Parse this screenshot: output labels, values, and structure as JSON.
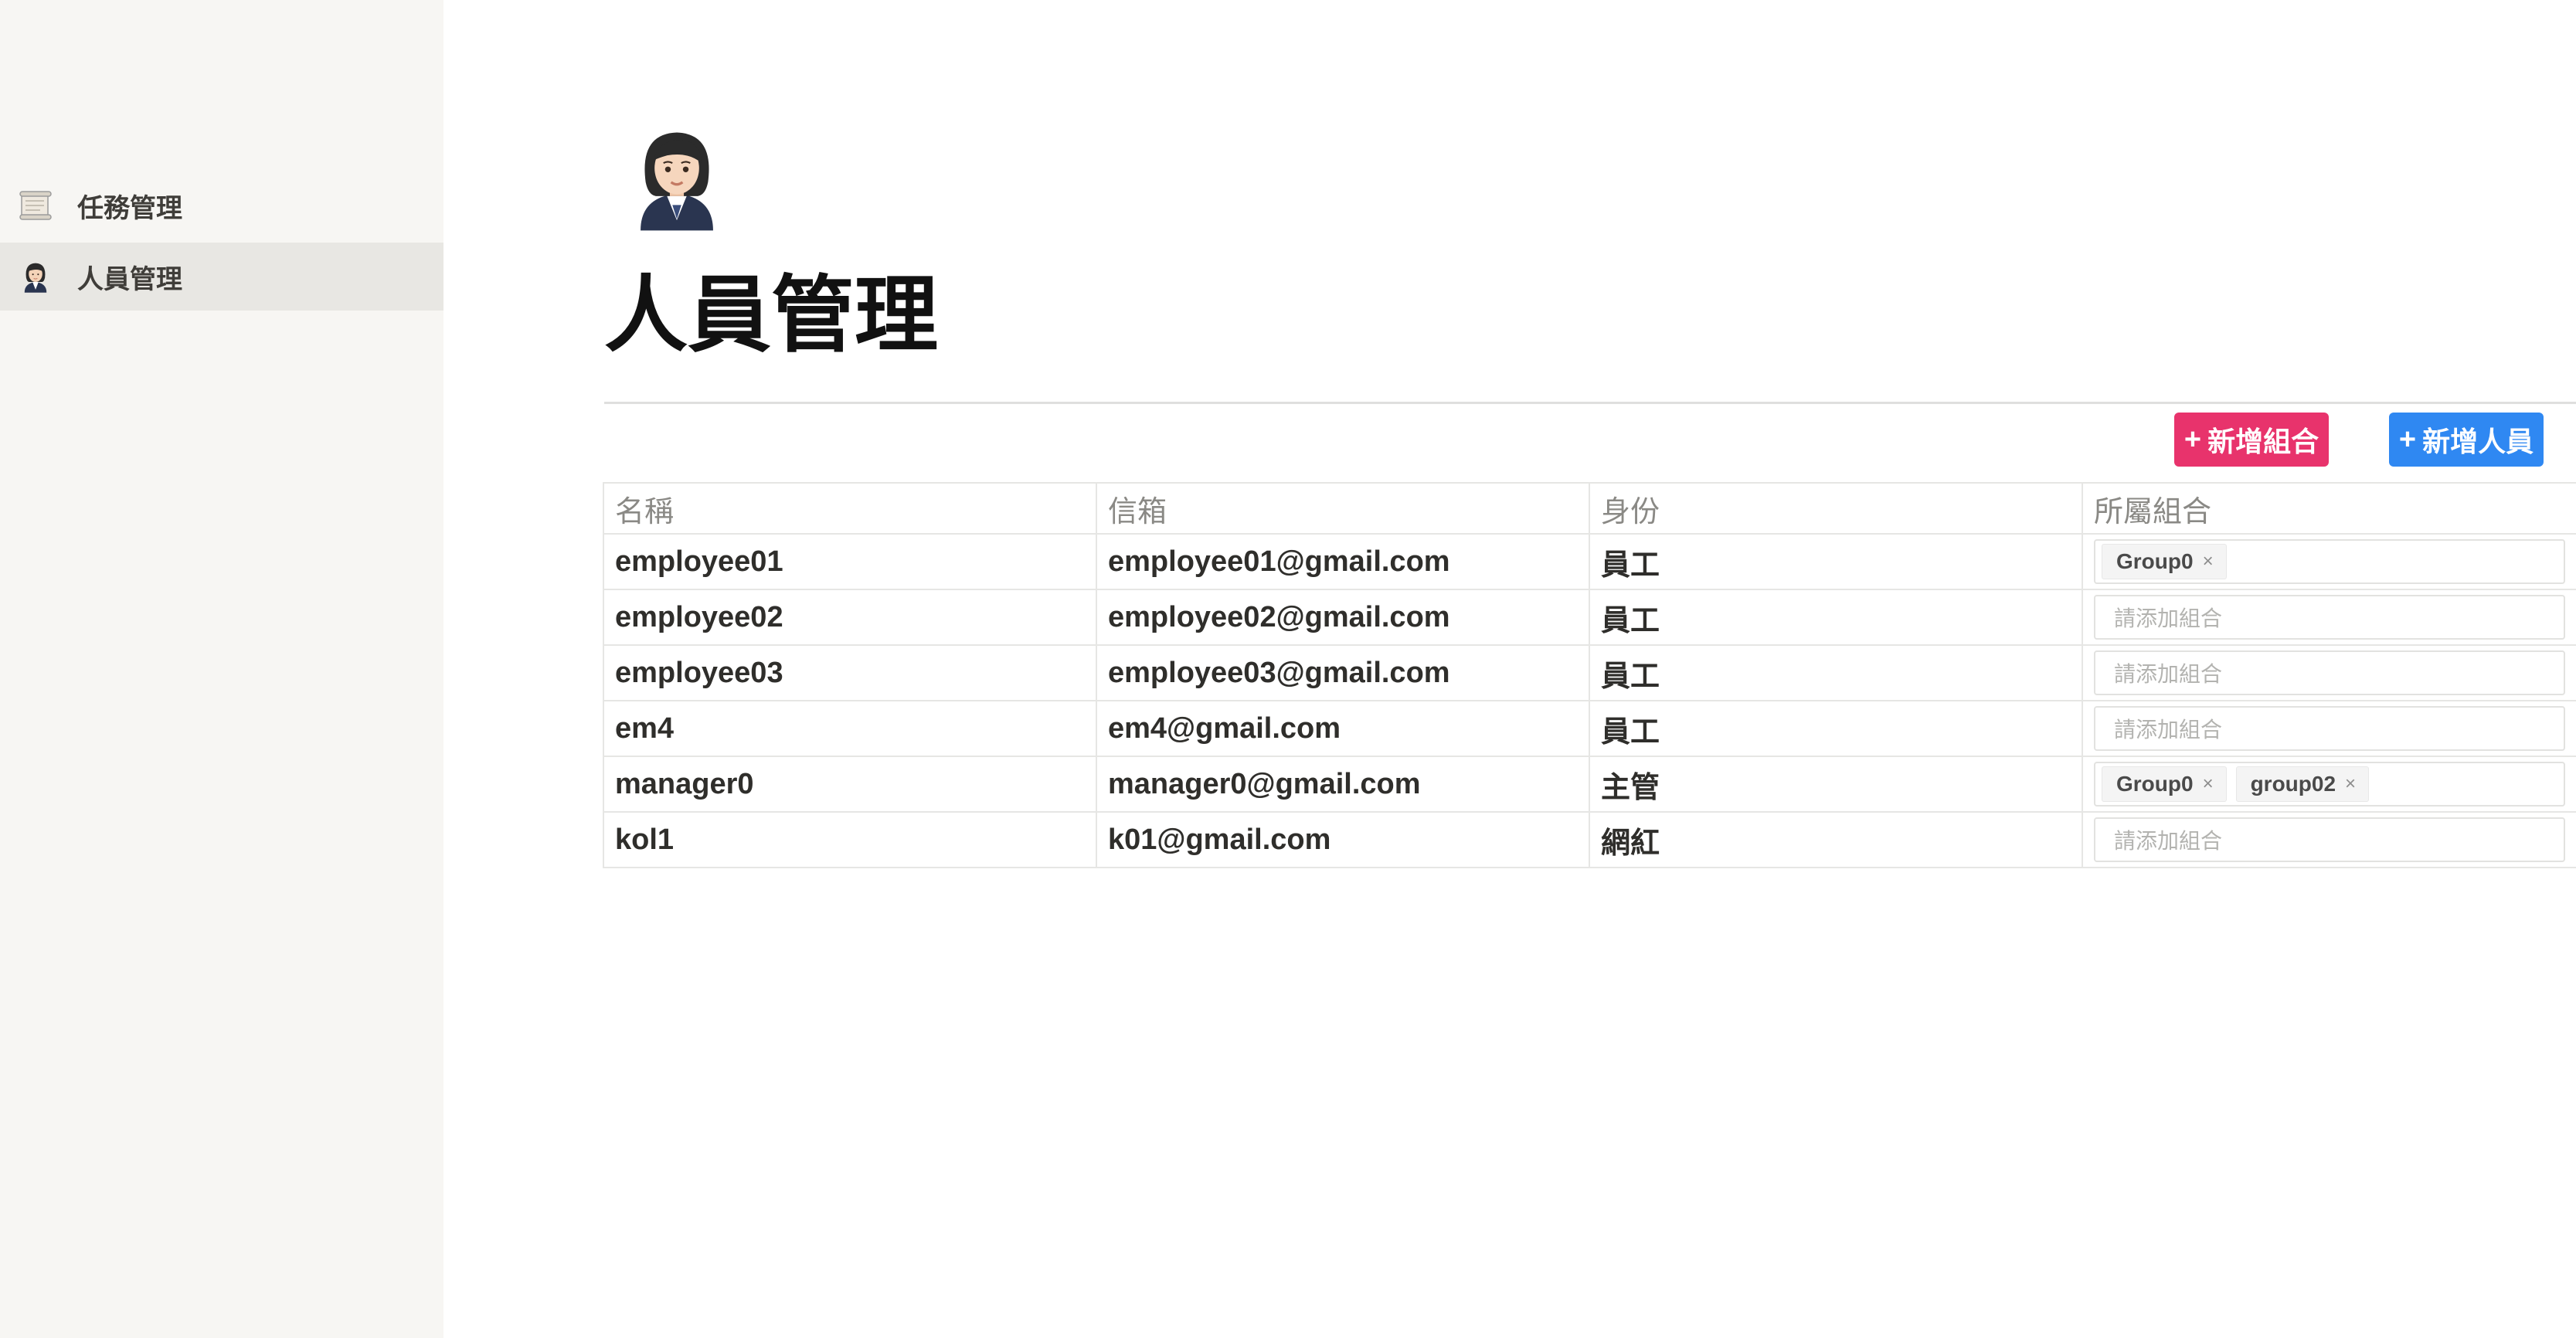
{
  "sidebar": {
    "items": [
      {
        "label": "任務管理",
        "icon": "scroll-icon",
        "active": false
      },
      {
        "label": "人員管理",
        "icon": "woman-office-worker-icon",
        "active": true
      }
    ]
  },
  "page": {
    "icon": "woman-office-worker-icon",
    "title": "人員管理"
  },
  "toolbar": {
    "add_group_label": "新增組合",
    "add_person_label": "新增人員",
    "plus_glyph": "+",
    "add_group_color": "#e8336c",
    "add_person_color": "#2f88f2"
  },
  "table": {
    "headers": [
      "名稱",
      "信箱",
      "身份",
      "所屬組合"
    ],
    "group_placeholder": "請添加組合",
    "tag_remove_glyph": "×",
    "rows": [
      {
        "name": "employee01",
        "email": "employee01@gmail.com",
        "role": "員工",
        "groups": [
          "Group0"
        ]
      },
      {
        "name": "employee02",
        "email": "employee02@gmail.com",
        "role": "員工",
        "groups": []
      },
      {
        "name": "employee03",
        "email": "employee03@gmail.com",
        "role": "員工",
        "groups": []
      },
      {
        "name": "em4",
        "email": "em4@gmail.com",
        "role": "員工",
        "groups": []
      },
      {
        "name": "manager0",
        "email": "manager0@gmail.com",
        "role": "主管",
        "groups": [
          "Group0",
          "group02"
        ]
      },
      {
        "name": "kol1",
        "email": "k01@gmail.com",
        "role": "網紅",
        "groups": []
      }
    ]
  }
}
